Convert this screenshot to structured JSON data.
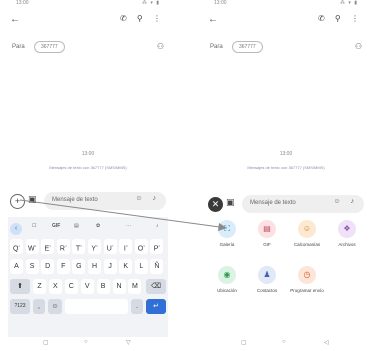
{
  "phone1": {
    "status": {
      "time": "13:00",
      "icons": "⁂ ▾ ▮"
    },
    "appbar": {
      "back": "←",
      "actions": "✆ ⚲ ⋮"
    },
    "para": {
      "label": "Para",
      "recipient": "367777",
      "add_icon": "person-add-icon"
    },
    "timestamp": "13:00",
    "note": "Mensajes de texto con 367777 (SMS/MMS)",
    "composer": {
      "plus": "+",
      "gallery": "▣",
      "placeholder": "Mensaje de texto",
      "icons": "☺ ♪"
    },
    "kbtoolbar": {
      "back": "‹",
      "sticker": "☐",
      "gif": "GIF",
      "clip": "▤",
      "gear": "✿",
      "dots": "···",
      "mic": "♪"
    },
    "keys_row1": [
      "Q",
      "W",
      "E",
      "R",
      "T",
      "Y",
      "U",
      "I",
      "O",
      "P"
    ],
    "keys_row1_sup": [
      "1",
      "2",
      "3",
      "4",
      "5",
      "6",
      "7",
      "8",
      "9",
      "0"
    ],
    "keys_row2": [
      "A",
      "S",
      "D",
      "F",
      "G",
      "H",
      "J",
      "K",
      "L",
      "Ñ"
    ],
    "keys_row3": [
      "Z",
      "X",
      "C",
      "V",
      "B",
      "N",
      "M"
    ],
    "shift": "⬆",
    "backspace": "⌫",
    "num_key": "?123",
    "comma": ",",
    "emoji": "☺",
    "period": ".",
    "enter": "↵",
    "nav": {
      "back": "▢",
      "home": "○",
      "recents": "▽"
    }
  },
  "phone2": {
    "status": {
      "time": "13:00",
      "icons": "⁂ ▾ ▮"
    },
    "appbar": {
      "back": "←",
      "actions": "✆ ⚲ ⋮"
    },
    "para": {
      "label": "Para",
      "recipient": "367777",
      "add_icon": "person-add-icon"
    },
    "timestamp": "13:00",
    "note": "Mensajes de texto con 367777 (SMS/MMS)",
    "composer": {
      "plus": "✕",
      "gallery": "▣",
      "placeholder": "Mensaje de texto",
      "icons": "☺ ♪"
    },
    "attach": [
      {
        "label": "Galería",
        "icon": "⛶",
        "color": "#1f6fc7",
        "bg": "#d9ecf9"
      },
      {
        "label": "GIF",
        "icon": "▤",
        "color": "#c94b5a",
        "bg": "#fbe1e4"
      },
      {
        "label": "Calcomanías",
        "icon": "☺",
        "color": "#d07a20",
        "bg": "#fde9d2"
      },
      {
        "label": "Archivos",
        "icon": "❖",
        "color": "#8752b0",
        "bg": "#efe1f8"
      },
      {
        "label": "Ubicación",
        "icon": "◉",
        "color": "#2f9a55",
        "bg": "#dcf2e2"
      },
      {
        "label": "Contactos",
        "icon": "♟",
        "color": "#3d62b8",
        "bg": "#e1e8f8"
      },
      {
        "label": "Programar envío",
        "icon": "◷",
        "color": "#d05a28",
        "bg": "#fde5d8"
      }
    ],
    "nav": {
      "back": "▢",
      "home": "○",
      "recents": "◁"
    }
  }
}
